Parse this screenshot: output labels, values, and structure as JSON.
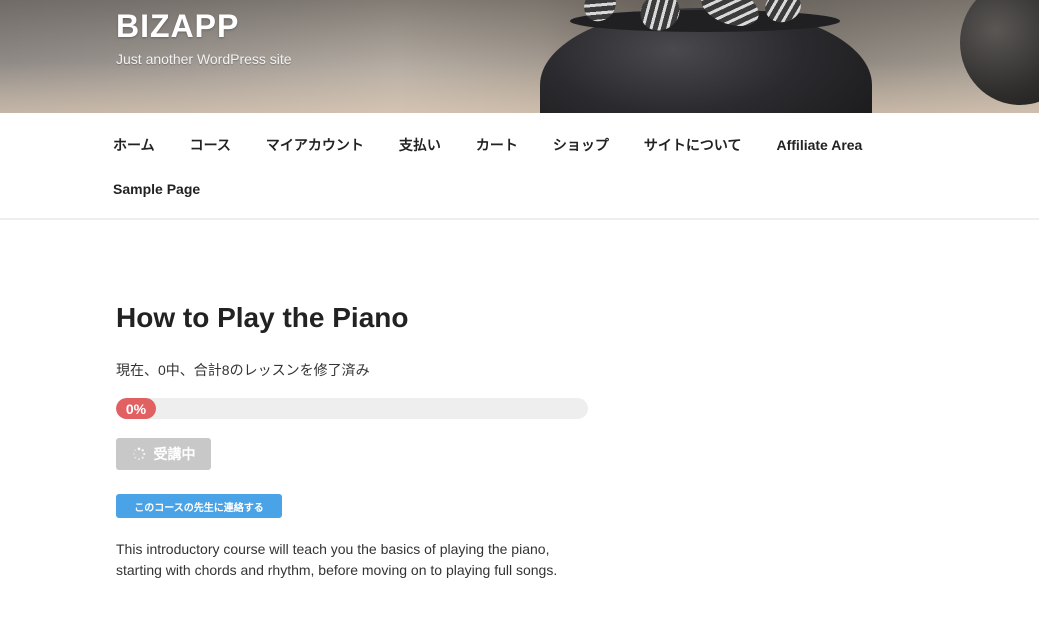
{
  "site": {
    "title": "BIZAPP",
    "description": "Just another WordPress site"
  },
  "nav": {
    "row1": [
      "ホーム",
      "コース",
      "マイアカウント",
      "支払い",
      "カート",
      "ショップ",
      "サイトについて",
      "Affiliate Area"
    ],
    "row2": [
      "Sample Page"
    ]
  },
  "course": {
    "title": "How to Play the Piano",
    "lesson_status": "現在、0中、合計8のレッスンを修了済み",
    "progress_label": "0%",
    "progress_value": 0,
    "enroll_label": "受講中",
    "contact_label": "このコースの先生に連絡する",
    "description": "This introductory course will teach you the basics of playing the piano, starting with chords and rhythm, before moving on to playing full songs."
  },
  "colors": {
    "progress_fill": "#e16162",
    "progress_track": "#eeeeee",
    "enroll_button": "#c8c8c8",
    "contact_button": "#4aa3e6"
  },
  "icons": {
    "enroll_icon": "spinner-icon"
  }
}
